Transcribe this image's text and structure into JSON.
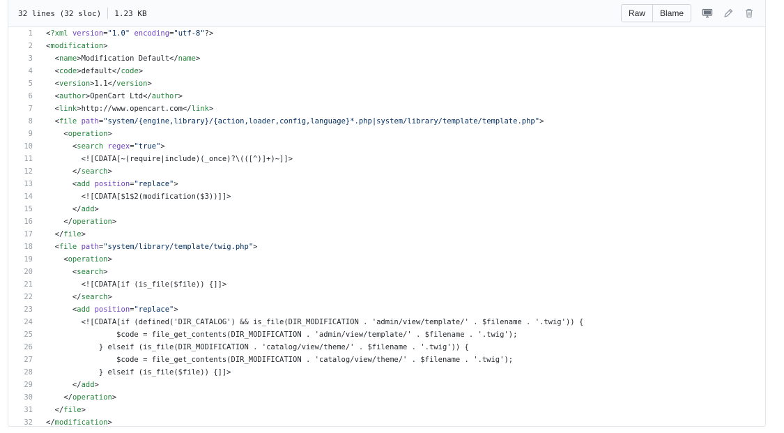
{
  "header": {
    "lines_info": "32 lines (32 sloc)",
    "size": "1.23 KB",
    "raw_label": "Raw",
    "blame_label": "Blame"
  },
  "colors": {
    "tag": "#22863a",
    "attr": "#6f42c1",
    "string": "#032f62",
    "line_number": "#959da5"
  },
  "code_lines": [
    "<?xml version=\"1.0\" encoding=\"utf-8\"?>",
    "<modification>",
    "  <name>Modification Default</name>",
    "  <code>default</code>",
    "  <version>1.1</version>",
    "  <author>OpenCart Ltd</author>",
    "  <link>http://www.opencart.com</link>",
    "  <file path=\"system/{engine,library}/{action,loader,config,language}*.php|system/library/template/template.php\">",
    "    <operation>",
    "      <search regex=\"true\">",
    "        <![CDATA[~(require|include)(_once)?\\(([^)]+)~]]>",
    "      </search>",
    "      <add position=\"replace\">",
    "        <![CDATA[$1$2(modification($3))]]>",
    "      </add>",
    "    </operation>",
    "  </file>",
    "  <file path=\"system/library/template/twig.php\">",
    "    <operation>",
    "      <search>",
    "        <![CDATA[if (is_file($file)) {]]>",
    "      </search>",
    "      <add position=\"replace\">",
    "        <![CDATA[if (defined('DIR_CATALOG') && is_file(DIR_MODIFICATION . 'admin/view/template/' . $filename . '.twig')) {",
    "                $code = file_get_contents(DIR_MODIFICATION . 'admin/view/template/' . $filename . '.twig');",
    "            } elseif (is_file(DIR_MODIFICATION . 'catalog/view/theme/' . $filename . '.twig')) {",
    "                $code = file_get_contents(DIR_MODIFICATION . 'catalog/view/theme/' . $filename . '.twig');",
    "            } elseif (is_file($file)) {]]>",
    "      </add>",
    "    </operation>",
    "  </file>",
    "</modification>"
  ]
}
